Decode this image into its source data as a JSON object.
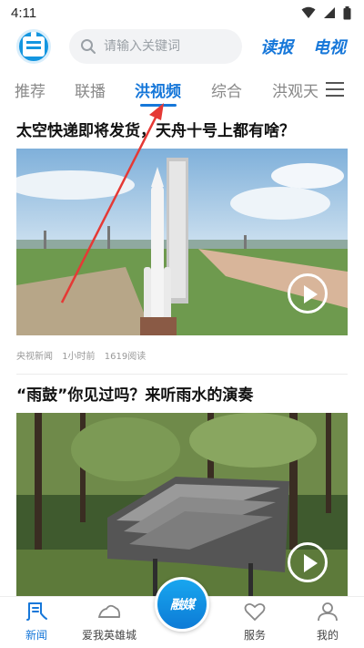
{
  "status_bar": {
    "time": "4:11"
  },
  "header": {
    "search_placeholder": "请输入关键词",
    "read_label": "读报",
    "tv_label": "电视"
  },
  "tabs": [
    {
      "label": "推荐"
    },
    {
      "label": "联播"
    },
    {
      "label": "洪视频",
      "active": true
    },
    {
      "label": "综合"
    },
    {
      "label": "洪观天"
    }
  ],
  "articles": [
    {
      "title": "太空快递即将发货，天舟十号上都有啥？",
      "meta": [
        "央视新闻",
        "1小时前",
        "1619阅读"
      ]
    },
    {
      "title": "“雨鼓”你见过吗？来听雨水的演奏"
    }
  ],
  "bottom_nav": {
    "items": [
      {
        "label": "新闻",
        "icon": "news-icon",
        "active": true
      },
      {
        "label": "爱我英雄城",
        "icon": "city-icon"
      },
      {
        "label": "服务",
        "icon": "heart-icon"
      },
      {
        "label": "我的",
        "icon": "profile-icon"
      }
    ],
    "center_label": "融媒"
  },
  "colors": {
    "accent": "#1677d9",
    "annotation_arrow": "#e53935"
  }
}
